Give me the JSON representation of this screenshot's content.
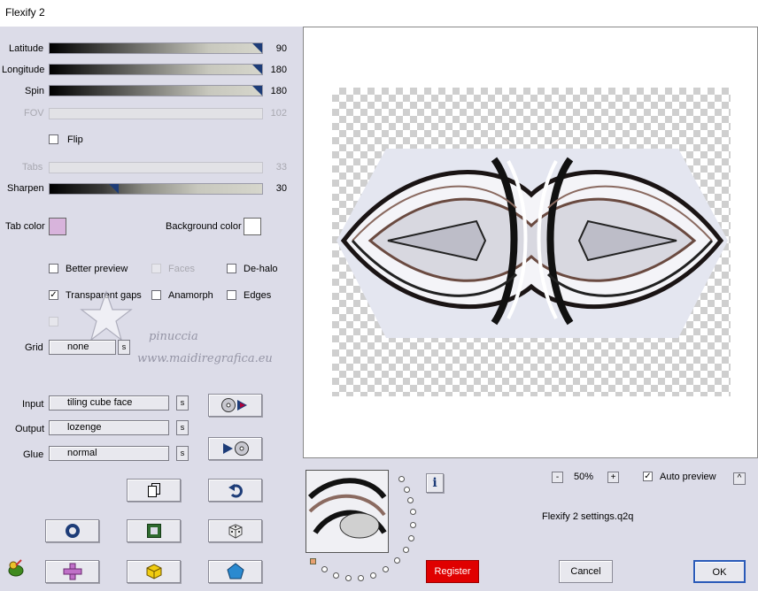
{
  "window": {
    "title": "Flexify 2"
  },
  "sliders": [
    {
      "label": "Latitude",
      "value": "90",
      "enabled": true,
      "level": 1.0
    },
    {
      "label": "Longitude",
      "value": "180",
      "enabled": true,
      "level": 1.0
    },
    {
      "label": "Spin",
      "value": "180",
      "enabled": true,
      "level": 1.0
    },
    {
      "label": "FOV",
      "value": "102",
      "enabled": false
    },
    {
      "label": "Tabs",
      "value": "33",
      "enabled": false
    },
    {
      "label": "Sharpen",
      "value": "30",
      "enabled": true,
      "level": 0.3
    }
  ],
  "flip": {
    "label": "Flip",
    "checked": false
  },
  "colors": {
    "tab_color_label": "Tab color",
    "tab_color": "#d8b4dc",
    "background_color_label": "Background color",
    "background_color": "#ffffff"
  },
  "options": {
    "better_preview": {
      "label": "Better preview",
      "checked": false
    },
    "faces": {
      "label": "Faces",
      "checked": false,
      "enabled": false
    },
    "de_halo": {
      "label": "De-halo",
      "checked": false
    },
    "transparent_gaps": {
      "label": "Transparent gaps",
      "checked": true
    },
    "anamorph": {
      "label": "Anamorph",
      "checked": false
    },
    "edges": {
      "label": "Edges",
      "checked": false
    }
  },
  "grid": {
    "label": "Grid",
    "value": "none",
    "s": "s"
  },
  "mapping": {
    "input_label": "Input",
    "input_value": "tiling cube face",
    "output_label": "Output",
    "output_value": "lozenge",
    "glue_label": "Glue",
    "glue_value": "normal",
    "s": "s"
  },
  "watermark": {
    "name": "pinuccia",
    "url": "www.maidiregrafica.eu"
  },
  "zoom": {
    "value": "50%",
    "minus": "-",
    "plus": "+"
  },
  "auto_preview": {
    "label": "Auto preview",
    "checked": true,
    "toggle": "^"
  },
  "settings_file": "Flexify 2 settings.q2q",
  "buttons": {
    "register": "Register",
    "cancel": "Cancel",
    "ok": "OK",
    "info": "i"
  },
  "accent_colors": {
    "register_bg": "#e00000",
    "ok_border": "#2a5ab8",
    "icon_blue": "#1d3c78"
  }
}
